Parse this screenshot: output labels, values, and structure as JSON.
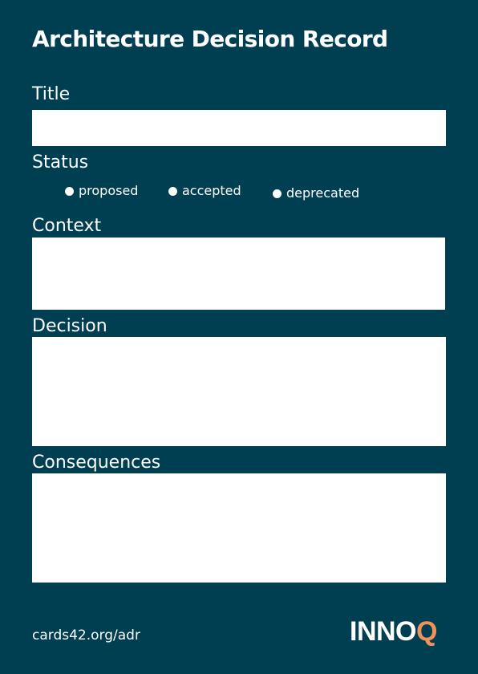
{
  "card": {
    "title": "Architecture Decision Record",
    "footer_url": "cards42.org/adr"
  },
  "fields": {
    "title_label": "Title",
    "status_label": "Status",
    "context_label": "Context",
    "decision_label": "Decision",
    "consequences_label": "Consequences"
  },
  "status_options": [
    "proposed",
    "accepted",
    "deprecated"
  ],
  "logo": {
    "main": "INNO",
    "accent": "Q"
  },
  "colors": {
    "background": "#003f52",
    "field": "#ffffff",
    "logo_accent": "#f0935a"
  }
}
